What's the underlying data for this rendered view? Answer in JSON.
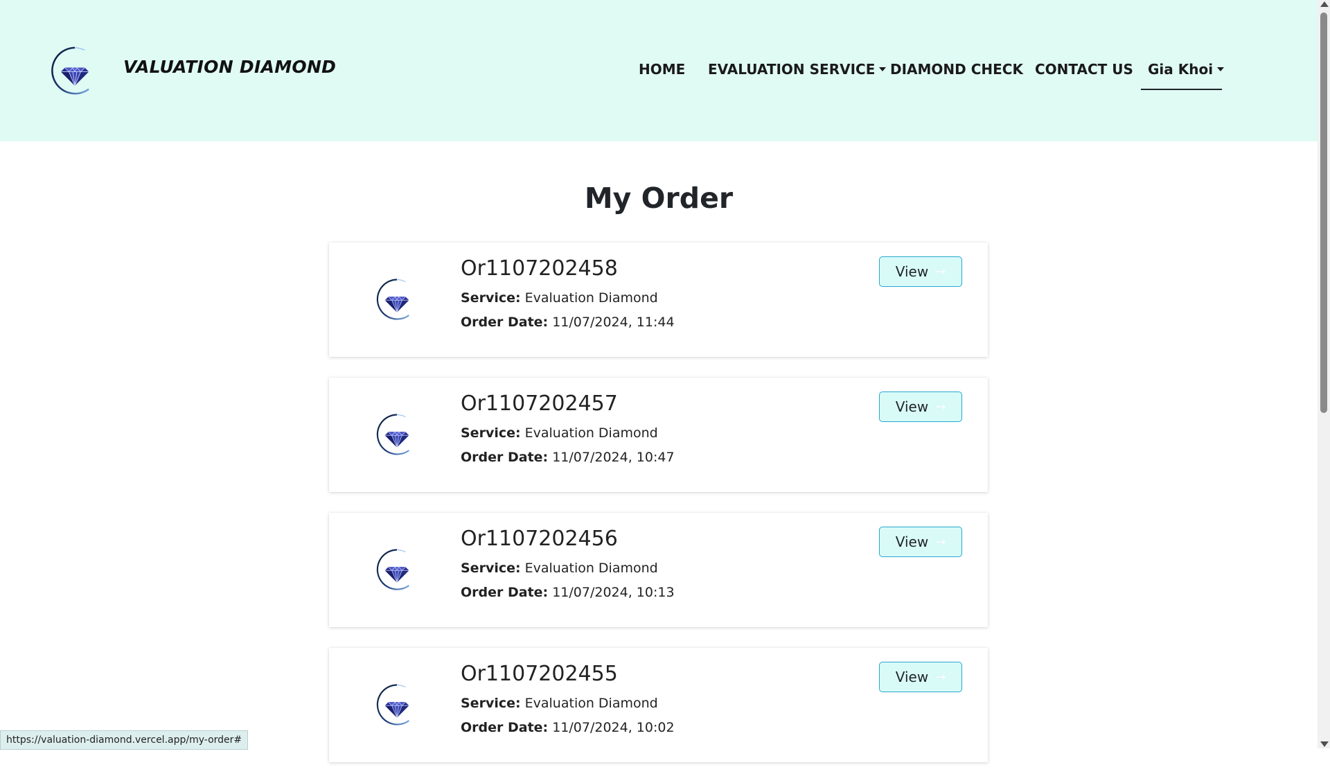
{
  "header": {
    "brand": "VALUATION DIAMOND",
    "nav": [
      {
        "label": "HOME"
      },
      {
        "label": "EVALUATION SERVICE"
      },
      {
        "label": "DIAMOND CHECK"
      },
      {
        "label": "CONTACT US"
      },
      {
        "label": "Gia Khoi"
      }
    ]
  },
  "page": {
    "title": "My Order"
  },
  "labels": {
    "service": "Service:",
    "order_date": "Order Date:",
    "view": "View"
  },
  "orders": [
    {
      "id": "Or1107202458",
      "service": "Evaluation Diamond",
      "date": "11/07/2024, 11:44"
    },
    {
      "id": "Or1107202457",
      "service": "Evaluation Diamond",
      "date": "11/07/2024, 10:47"
    },
    {
      "id": "Or1107202456",
      "service": "Evaluation Diamond",
      "date": "11/07/2024, 10:13"
    },
    {
      "id": "Or1107202455",
      "service": "Evaluation Diamond",
      "date": "11/07/2024, 10:02"
    }
  ],
  "status_bar": {
    "url": "https://valuation-diamond.vercel.app/my-order#"
  },
  "colors": {
    "header_bg": "#e0faf4",
    "button_bg": "#d9fbf8",
    "button_border": "#26a7cf",
    "diamond": "#1e2a78"
  },
  "icons": {
    "logo": "diamond-logo-icon",
    "caret": "caret-down-icon",
    "arrow": "arrow-right-icon"
  }
}
